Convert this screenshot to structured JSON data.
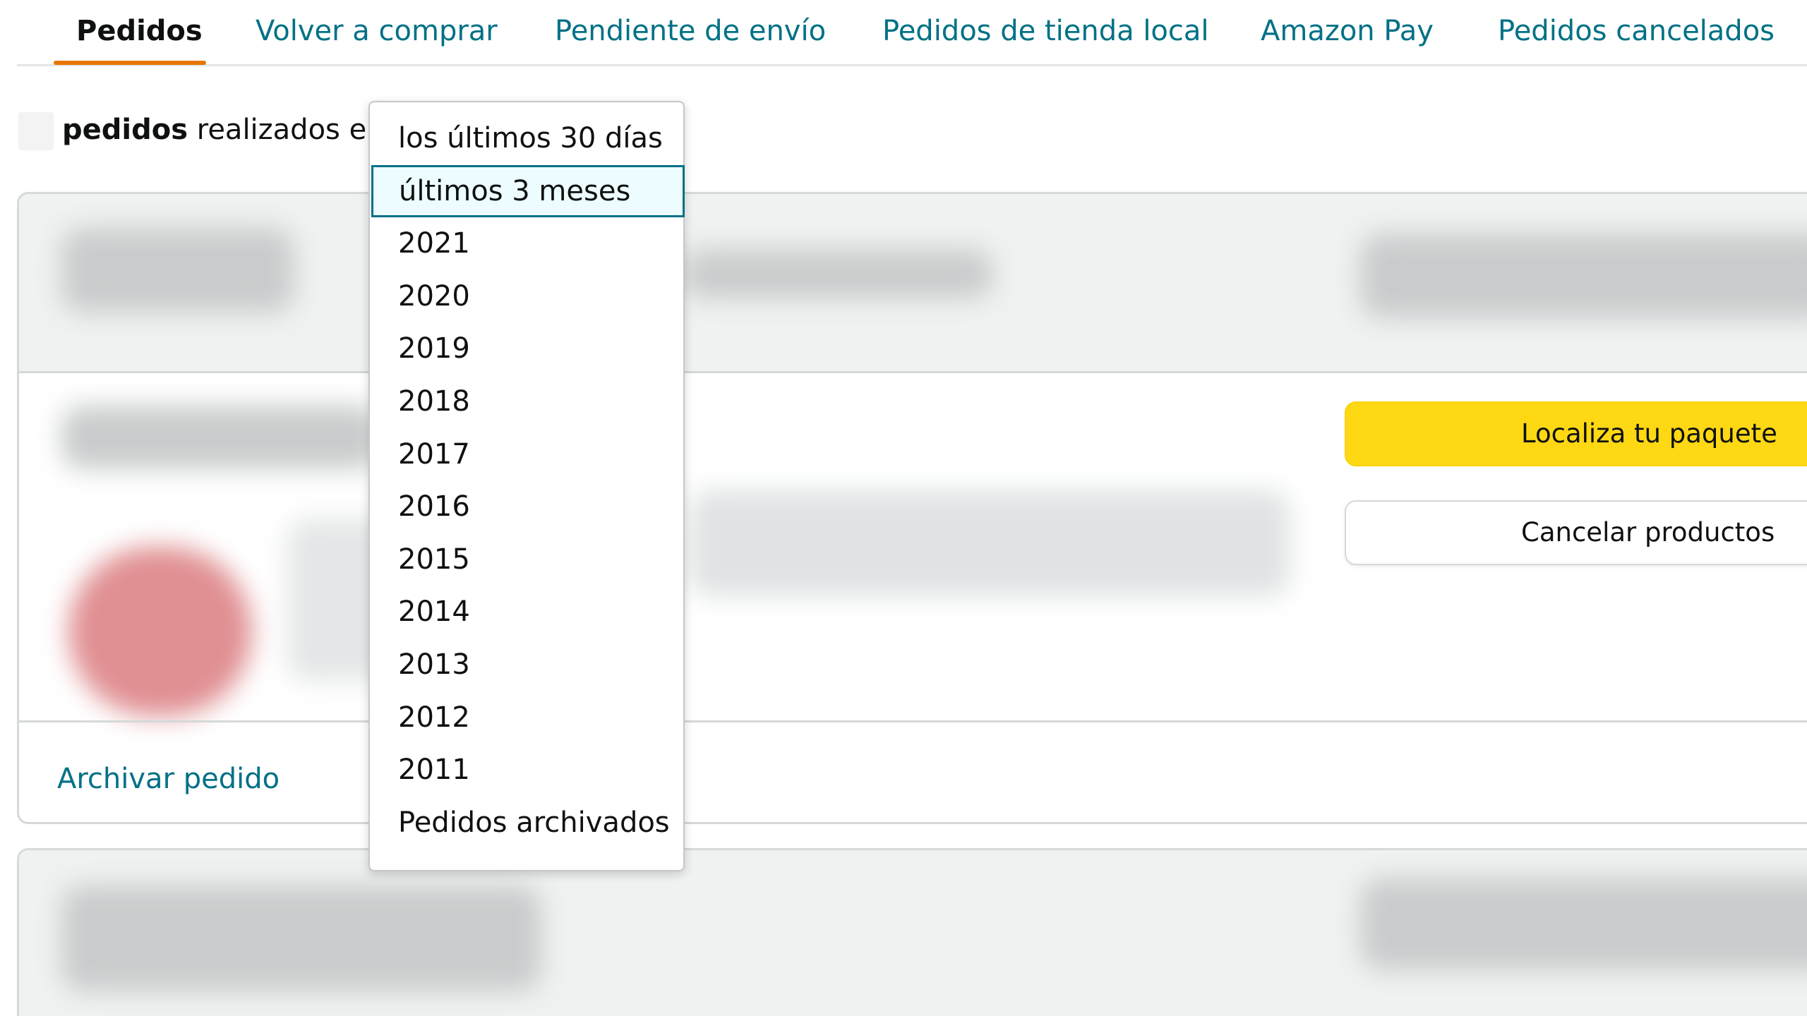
{
  "tabs": [
    {
      "label": "Pedidos",
      "active": true
    },
    {
      "label": "Volver a comprar"
    },
    {
      "label": "Pendiente de envío"
    },
    {
      "label": "Pedidos de tienda local"
    },
    {
      "label": "Amazon Pay"
    },
    {
      "label": "Pedidos cancelados"
    }
  ],
  "summary": {
    "count": "",
    "orders_word": "pedidos",
    "placed_in": "realizados en"
  },
  "dropdown": {
    "selected_index": 1,
    "options": [
      "los últimos 30 días",
      "últimos 3 meses",
      "2021",
      "2020",
      "2019",
      "2018",
      "2017",
      "2016",
      "2015",
      "2014",
      "2013",
      "2012",
      "2011",
      "Pedidos archivados"
    ]
  },
  "order": {
    "track_label": "Localiza tu paquete",
    "cancel_label": "Cancelar productos",
    "archive_label": "Archivar pedido"
  },
  "colors": {
    "link": "#007185",
    "tab_underline": "#e77600",
    "primary_button": "#ffd814",
    "card_header": "#f0f2f2",
    "highlight_bg": "#edfdff"
  }
}
